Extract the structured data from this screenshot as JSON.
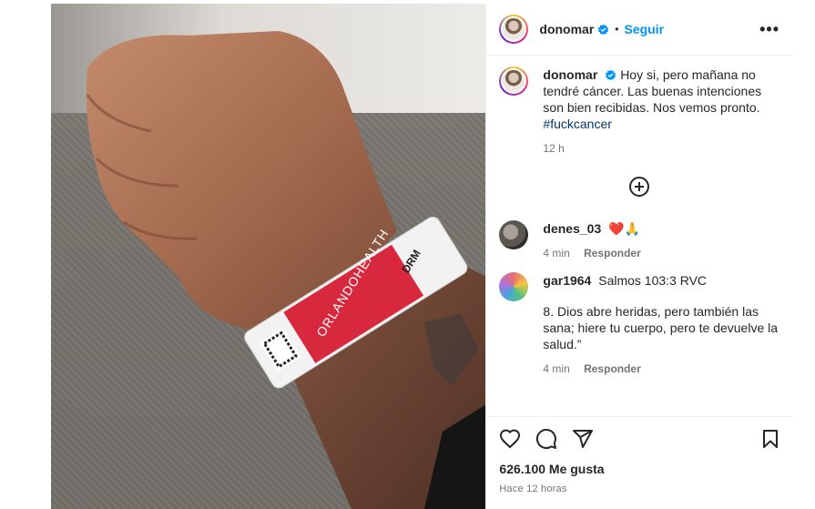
{
  "post": {
    "username": "donomar",
    "follow_label": "Seguir",
    "dot": "•",
    "more_label": "•••",
    "caption": {
      "text": "Hoy si, pero mañana no tendré cáncer. Las buenas intenciones son bien recibidas. Nos vemos pronto.",
      "hashtag": "#fuckcancer",
      "time": "12 h"
    },
    "comments": [
      {
        "username": "denes_03",
        "text": "❤️🙏",
        "time": "4 min",
        "reply_label": "Responder"
      },
      {
        "username": "gar1964",
        "text": "Salmos 103:3 RVC",
        "text2": "8. Dios abre heridas, pero también las sana; hiere tu cuerpo, pero te devuelve la salud.”",
        "time": "4 min",
        "reply_label": "Responder"
      }
    ],
    "likes": "626.100 Me gusta",
    "time_ago": "Hace 12 horas",
    "wristband_text": "ORLANDOHEALTH",
    "wristband_side": "DRM"
  },
  "colors": {
    "accent": "#0095f6",
    "band_red": "#d8283e",
    "text": "#262626",
    "muted": "#737373"
  },
  "icons": [
    "verified-badge-icon",
    "more-icon",
    "add-comment-icon",
    "heart-icon",
    "comment-icon",
    "share-icon",
    "save-icon"
  ]
}
